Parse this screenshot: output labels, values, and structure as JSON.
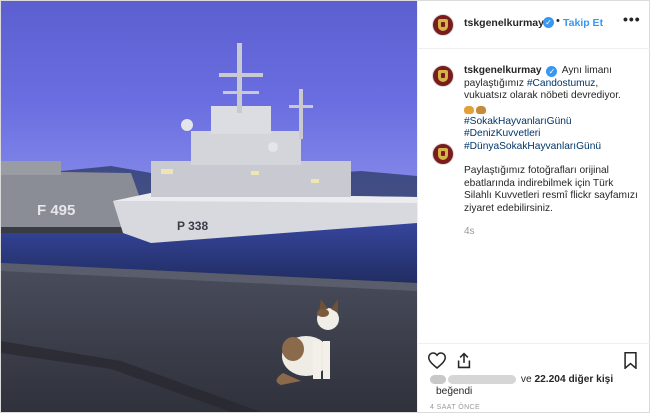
{
  "post": {
    "username": "tskgenelkurmay",
    "follow_label": "Takip Et",
    "more_label": "•••",
    "separator": "•"
  },
  "photo": {
    "ship1_hull_number": "F 495",
    "ship2_hull_number": "P 338"
  },
  "caption": {
    "username": "tskgenelkurmay",
    "text_part1": "Aynı limanı paylaştığımız",
    "hashtag1": "#Candostumuz",
    "text_part2": ", vukuatsız olarak nöbeti devrediyor.",
    "hashtags": [
      "#SokakHayvanlarıGünü",
      "#DenizKuvvetleri",
      "#DünyaSokakHayvanlarıGünü"
    ]
  },
  "comment": {
    "text": "Paylaştığımız fotoğrafları orijinal ebatlarında indirebilmek için Türk Silahlı Kuvvetleri resmî flickr sayfamızı ziyaret edebilirsiniz.",
    "time": "4s"
  },
  "likes": {
    "prefix_visible": "ve",
    "count_text": "22.204 diğer kişi",
    "suffix": "beğendi"
  },
  "timestamp": "4 SAAT ÖNCE",
  "icons": [
    "heart-icon",
    "share-icon",
    "bookmark-icon",
    "verified-icon",
    "emblem-avatar"
  ],
  "colors": {
    "link": "#3897f0",
    "hashtag": "#003569",
    "muted": "#999999"
  }
}
